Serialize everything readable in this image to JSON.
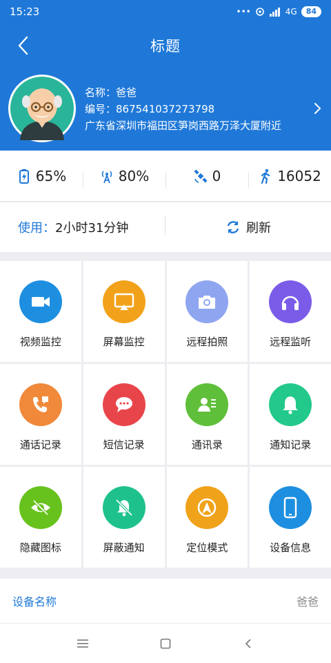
{
  "status": {
    "time": "15:23",
    "dots": "•••",
    "network": "4G",
    "battery": "84"
  },
  "header": {
    "title": "标题"
  },
  "profile": {
    "name": "名称：爸爸",
    "id": "编号：867541037273798",
    "address": "广东省深圳市福田区笋岗西路万泽大厦附近"
  },
  "stats": {
    "battery": "65%",
    "signal": "80%",
    "satellites": "0",
    "steps": "16052"
  },
  "usage": {
    "label": "使用：",
    "value": "2小时31分钟",
    "refresh": "刷新"
  },
  "functions": [
    {
      "label": "视频监控",
      "icon": "video-camera-icon",
      "color": "#1e8fe0"
    },
    {
      "label": "屏幕监控",
      "icon": "screen-cast-icon",
      "color": "#f2a21a"
    },
    {
      "label": "远程拍照",
      "icon": "photo-camera-icon",
      "color": "#8ea5f0"
    },
    {
      "label": "远程监听",
      "icon": "headphones-icon",
      "color": "#7b5ce8"
    },
    {
      "label": "通话记录",
      "icon": "phone-icon",
      "color": "#f0893a"
    },
    {
      "label": "短信记录",
      "icon": "message-icon",
      "color": "#e8454a"
    },
    {
      "label": "通讯录",
      "icon": "contacts-icon",
      "color": "#5fbf3a"
    },
    {
      "label": "通知记录",
      "icon": "bell-icon",
      "color": "#23c98a"
    },
    {
      "label": "隐藏图标",
      "icon": "eye-hidden-icon",
      "color": "#68c21d"
    },
    {
      "label": "屏蔽通知",
      "icon": "bell-off-icon",
      "color": "#1ec18c"
    },
    {
      "label": "定位模式",
      "icon": "location-mode-icon",
      "color": "#f0a21a"
    },
    {
      "label": "设备信息",
      "icon": "mobile-device-icon",
      "color": "#1e8fe0"
    }
  ],
  "device": {
    "label": "设备名称",
    "value": "爸爸"
  },
  "colors": {
    "primary": "#1f78d8"
  }
}
